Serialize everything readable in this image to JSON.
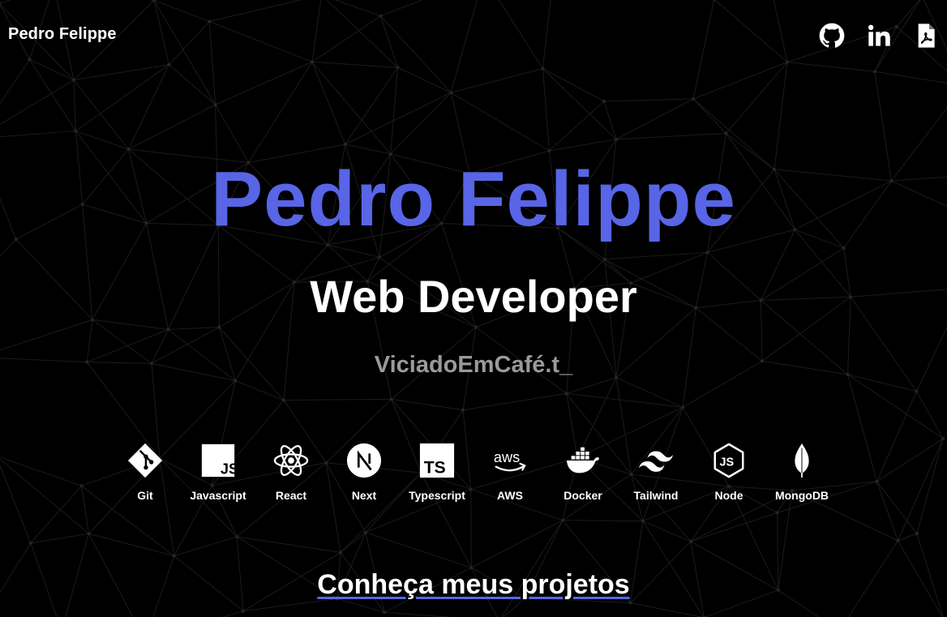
{
  "header": {
    "brand": "Pedro Felippe",
    "social": [
      {
        "name": "github-icon"
      },
      {
        "name": "linkedin-icon"
      },
      {
        "name": "pdf-icon"
      }
    ]
  },
  "hero": {
    "name": "Pedro Felippe",
    "role": "Web Developer",
    "typing_text": "ViciadoEmCafé.t_"
  },
  "skills": [
    {
      "label": "Git",
      "icon": "git-icon"
    },
    {
      "label": "Javascript",
      "icon": "javascript-icon"
    },
    {
      "label": "React",
      "icon": "react-icon"
    },
    {
      "label": "Next",
      "icon": "nextjs-icon"
    },
    {
      "label": "Typescript",
      "icon": "typescript-icon"
    },
    {
      "label": "AWS",
      "icon": "aws-icon"
    },
    {
      "label": "Docker",
      "icon": "docker-icon"
    },
    {
      "label": "Tailwind",
      "icon": "tailwind-icon"
    },
    {
      "label": "Node",
      "icon": "nodejs-icon"
    },
    {
      "label": "MongoDB",
      "icon": "mongodb-icon"
    }
  ],
  "cta": {
    "label": "Conheça meus projetos"
  },
  "colors": {
    "background": "#000000",
    "accent": "#5865e6",
    "muted_text": "#9a9a9a",
    "text": "#ffffff"
  }
}
